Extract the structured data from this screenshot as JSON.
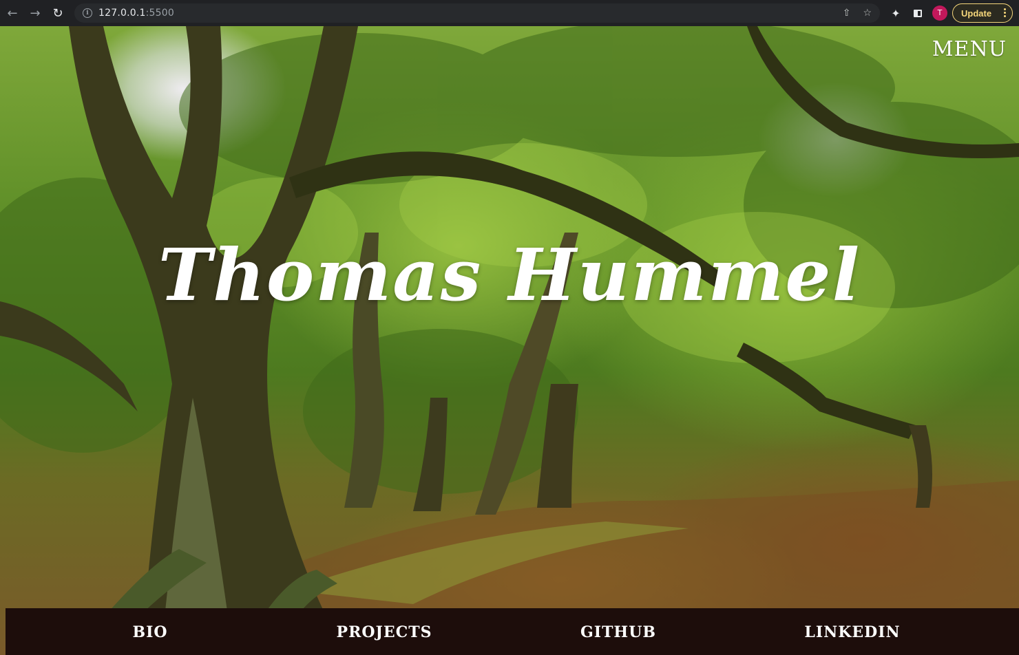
{
  "browser": {
    "url_host": "127.0.0.1",
    "url_port": ":5500",
    "avatar_initial": "T",
    "update_label": "Update",
    "icons": {
      "back": "arrow-left-icon",
      "forward": "arrow-right-icon",
      "reload": "reload-icon",
      "site_info": "info-icon",
      "share": "share-icon",
      "bookmark": "star-icon",
      "extensions": "puzzle-icon",
      "side_panel": "side-panel-icon",
      "more": "kebab-menu-icon"
    },
    "colors": {
      "update_accent": "#f6d77b",
      "avatar_bg": "#c2185b"
    }
  },
  "page": {
    "menu_label": "MENU",
    "title": "Thomas Hummel",
    "background": "forest-photo",
    "nav": [
      {
        "label": "BIO"
      },
      {
        "label": "PROJECTS"
      },
      {
        "label": "GITHUB"
      },
      {
        "label": "LINKEDIN"
      }
    ],
    "colors": {
      "nav_bg": "#1d0d0b",
      "text": "#ffffff"
    }
  }
}
